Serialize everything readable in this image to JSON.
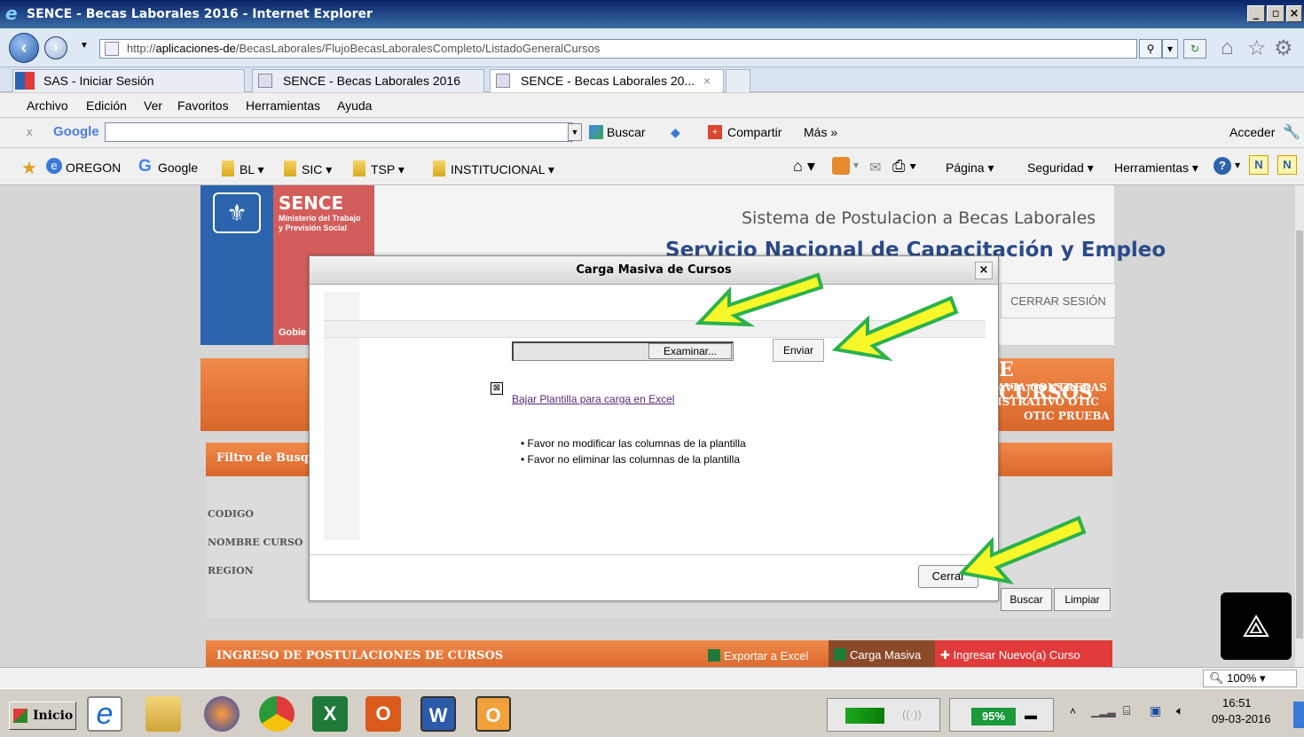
{
  "window": {
    "title": "SENCE - Becas Laborales 2016 - Internet Explorer",
    "min": "_",
    "max": "▫",
    "close": "×"
  },
  "address": {
    "prefix": "http://",
    "host": "aplicaciones-de",
    "path": "/BecasLaborales/FlujoBecasLaboralesCompleto/ListadoGeneralCursos"
  },
  "tabs": [
    {
      "label": "SAS - Iniciar Sesión"
    },
    {
      "label": "SENCE - Becas Laborales 2016"
    },
    {
      "label": "SENCE - Becas Laborales 20...",
      "close": "×"
    }
  ],
  "menu": [
    "Archivo",
    "Edición",
    "Ver",
    "Favoritos",
    "Herramientas",
    "Ayuda"
  ],
  "google_bar": {
    "close": "x",
    "logo": "Google",
    "buscar": "Buscar",
    "compartir": "Compartir",
    "mas": "Más »",
    "acceder": "Acceder"
  },
  "favorites": [
    "OREGON",
    "Google",
    "BL",
    "SIC",
    "TSP",
    "INSTITUCIONAL"
  ],
  "command_bar": [
    "Página",
    "Seguridad",
    "Herramientas"
  ],
  "page": {
    "logo_title": "SENCE",
    "logo_sub1": "Ministerio del Trabajo",
    "logo_sub2": "y Previsión Social",
    "logo_gob": "Gobie",
    "system_title": "Sistema de Postulacion a Becas Laborales",
    "service_title": "Servicio Nacional de Capacitación y Empleo",
    "cerrar_sesion": "CERRAR SESIÓN",
    "cursos_title": "E CURSOS",
    "user_line1": "AVIA CONTRERAS",
    "user_line2": "ISTRATIVO OTIC",
    "user_line3": "OTIC PRUEBA",
    "filter_title": "Filtro de Busq",
    "label_codigo": "CODIGO",
    "label_nombre": "NOMBRE CURSO",
    "label_region": "REGION",
    "btn_buscar": "Buscar",
    "btn_limpiar": "Limpiar",
    "ingreso_title": "INGRESO DE POSTULACIONES DE CURSOS",
    "exportar": "Exportar a Excel",
    "carga_masiva": "Carga Masiva",
    "ingresar": "Ingresar Nuevo(a) Curso"
  },
  "dialog": {
    "title": "Carga Masiva de Cursos",
    "close": "×",
    "examinar": "Examinar...",
    "enviar": "Enviar",
    "link": "Bajar Plantilla para carga en Excel",
    "notes": [
      "Favor no modificar las columnas de la plantilla",
      "Favor no eliminar las columnas de la plantilla"
    ],
    "cerrar": "Cerrar"
  },
  "status": {
    "zoom": "100%"
  },
  "taskbar": {
    "start": "Inicio",
    "battery": "95%",
    "time": "16:51",
    "date": "09-03-2016"
  },
  "colors": {
    "arrow_fill": "#f7f72a",
    "arrow_stroke": "#2bb24c",
    "orange": "#e2743a",
    "red": "#e03a3a"
  }
}
